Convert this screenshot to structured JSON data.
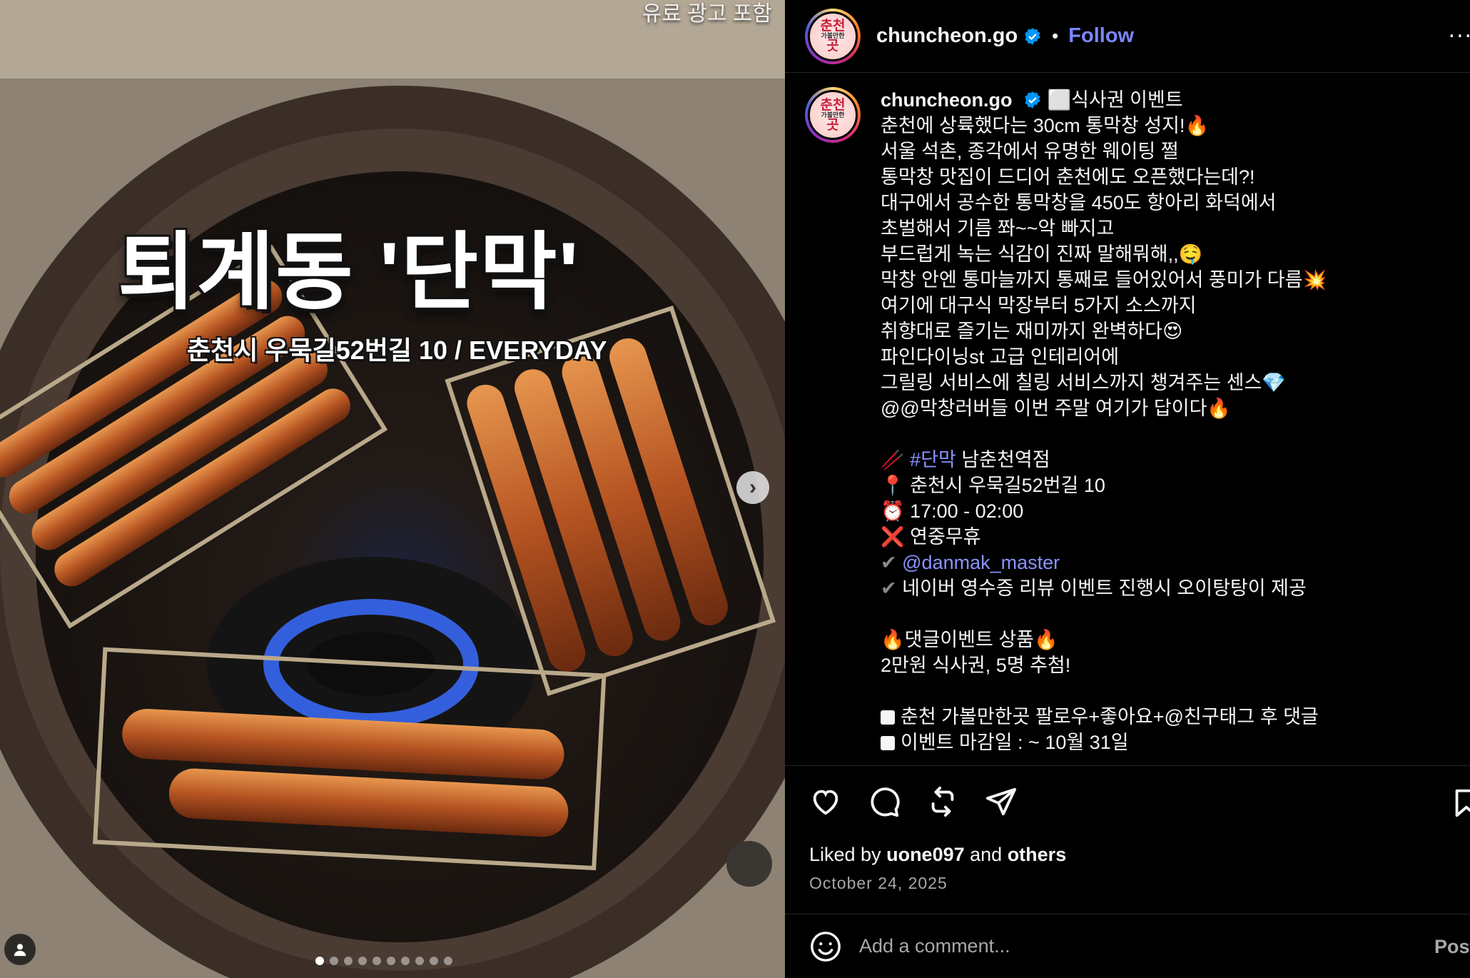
{
  "media": {
    "ad_label": "유료 광고 포함",
    "overlay_title": "퇴계동 '단막'",
    "overlay_subtitle": "춘천시 우묵길52번길 10 / EVERYDAY",
    "next_icon": "chevron-right-icon",
    "carousel_count": 10,
    "carousel_active": 1
  },
  "account": {
    "username": "chuncheon.go",
    "avatar_text": [
      "춘천",
      "가볼만한",
      "곳"
    ],
    "verified_color": "#0095f6"
  },
  "header": {
    "separator": "•",
    "follow_label": "Follow",
    "more_label": "..."
  },
  "caption": {
    "lines": [
      "⬜식사권 이벤트",
      "춘천에 상륙했다는 30cm 통막창 성지!🔥",
      "서울 석촌, 종각에서 유명한 웨이팅 쩔",
      "통막창 맛집이 드디어 춘천에도 오픈했다는데?!",
      "대구에서 공수한 통막창을 450도 항아리 화덕에서",
      "초벌해서 기름 쫘~~악 빠지고",
      "부드럽게 녹는 식감이 진짜 말해뭐해,,🤤",
      "막창 안엔 통마늘까지 통째로 들어있어서 풍미가 다름💥",
      "여기에 대구식 막장부터 5가지 소스까지",
      "취향대로 즐기는 재미까지 완벽하다😍",
      "파인다이닝st 고급 인테리어에",
      "그릴링 서비스에 칠링 서비스까지 챙겨주는 센스💎",
      "@@막창러버들 이번 주말 여기가 답이다🔥"
    ],
    "info": {
      "chopsticks_emoji": "🥢",
      "hashtag": "#단막",
      "branch": " 남춘천역점",
      "address": "📍 춘천시 우묵길52번길 10",
      "hours": "⏰ 17:00 - 02:00",
      "closed": "❌ 연중무휴",
      "check_mark": "✔",
      "mention": "@danmak_master",
      "review_event": "네이버 영수증 리뷰 이벤트 진행시 오이탕탕이 제공"
    },
    "event": {
      "title": "🔥댓글이벤트 상품🔥",
      "prize": "2만원 식사권, 5명 추첨!",
      "rule1": "춘천 가볼만한곳 팔로우+좋아요+@친구태그 후 댓글",
      "rule2": "이벤트 마감일 : ~ 10월 31일"
    }
  },
  "stats": {
    "liked_by_prefix": "Liked by ",
    "liked_by_user": "uone097",
    "liked_by_mid": " and ",
    "liked_by_others": "others",
    "date": "October 24, 2025"
  },
  "comment": {
    "placeholder": "Add a comment...",
    "post_label": "Post"
  },
  "icons": {
    "like": "heart-icon",
    "comment": "comment-icon",
    "repost": "repost-icon",
    "share": "share-icon",
    "save": "bookmark-icon",
    "emoji": "emoji-icon"
  }
}
